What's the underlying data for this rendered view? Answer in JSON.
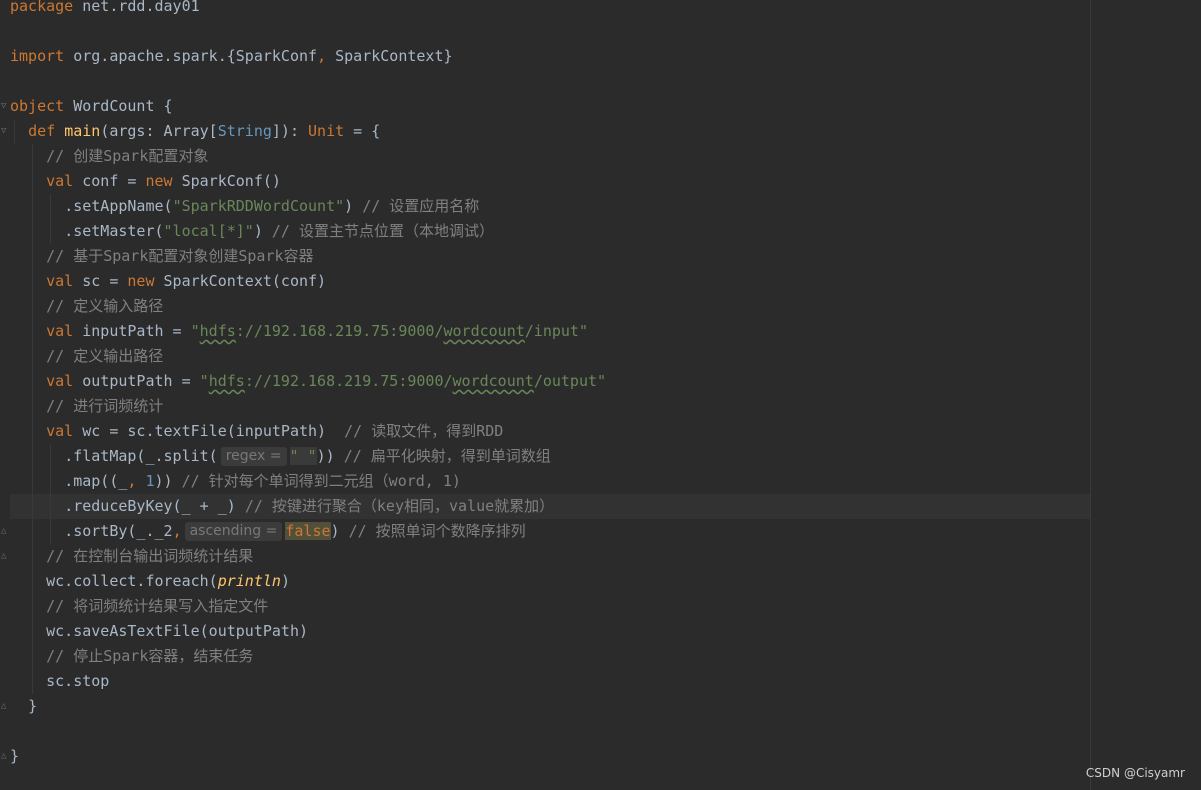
{
  "editor": {
    "language": "scala",
    "colors": {
      "background": "#2b2b2b",
      "keyword": "#cc7832",
      "function": "#ffc66d",
      "string": "#6a8759",
      "comment": "#808080",
      "number": "#6897bb",
      "plain": "#a9b7c6"
    }
  },
  "code": {
    "l1": {
      "kw": "package",
      "rest": " net.rdd.day01"
    },
    "l3": {
      "kw": "import",
      "rest": " org.apache.spark.{SparkConf",
      "comma": ",",
      "rest2": " SparkContext}"
    },
    "l5": {
      "kw": "object",
      "rest": " WordCount {"
    },
    "l6": {
      "kw": "def",
      "fn": "main",
      "a": "(args: Array[",
      "ty": "String",
      "b": "]): ",
      "ty2": "Unit",
      "c": " = {"
    },
    "l7": {
      "cm": "// 创建Spark配置对象"
    },
    "l8": {
      "kw": "val",
      "a": " conf = ",
      "kw2": "new",
      "b": " SparkConf()"
    },
    "l9": {
      "a": ".setAppName(",
      "str": "\"SparkRDDWordCount\"",
      "b": ") ",
      "cm": "// 设置应用名称"
    },
    "l10": {
      "a": ".setMaster(",
      "str": "\"local[*]\"",
      "b": ") ",
      "cm": "// 设置主节点位置（本地调试）"
    },
    "l11": {
      "cm": "// 基于Spark配置对象创建Spark容器"
    },
    "l12": {
      "kw": "val",
      "a": " sc = ",
      "kw2": "new",
      "b": " SparkContext(conf)"
    },
    "l13": {
      "cm": "// 定义输入路径"
    },
    "l14": {
      "kw": "val",
      "a": " inputPath = ",
      "s1": "\"",
      "s2": "hdfs",
      "s3": "://192.168.219.75:9000/",
      "s4": "wordcount",
      "s5": "/input\""
    },
    "l15": {
      "cm": "// 定义输出路径"
    },
    "l16": {
      "kw": "val",
      "a": " outputPath = ",
      "s1": "\"",
      "s2": "hdfs",
      "s3": "://192.168.219.75:9000/",
      "s4": "wordcount",
      "s5": "/output\""
    },
    "l17": {
      "cm": "// 进行词频统计"
    },
    "l18": {
      "kw": "val",
      "a": " wc = sc.textFile(inputPath)  ",
      "cm": "// 读取文件，得到RDD"
    },
    "l19": {
      "a": ".flatMap(_.split(",
      "hint": "regex =",
      "str": "\" \"",
      "b": ")) ",
      "cm": "// 扁平化映射，得到单词数组"
    },
    "l20": {
      "a": ".map((_",
      "comma": ",",
      "sp": " ",
      "num": "1",
      "b": ")) ",
      "cm": "// 针对每个单词得到二元组（word, 1)"
    },
    "l21": {
      "a": ".reduceByKey(_ + _) ",
      "cm": "// 按键进行聚合（key相同，value就累加）"
    },
    "l22": {
      "a": ".sortBy(_._2",
      "comma": ",",
      "hint": "ascending =",
      "kw": "false",
      "b": ") ",
      "cm": "// 按照单词个数降序排列"
    },
    "l23": {
      "cm": "// 在控制台输出词频统计结果"
    },
    "l24": {
      "a": "wc.collect.foreach(",
      "it": "println",
      "b": ")"
    },
    "l25": {
      "cm": "// 将词频统计结果写入指定文件"
    },
    "l26": {
      "a": "wc.saveAsTextFile(outputPath)"
    },
    "l27": {
      "cm": "// 停止Spark容器，结束任务"
    },
    "l28": {
      "a": "sc.stop"
    },
    "l29": {
      "a": "}"
    },
    "l31": {
      "a": "}"
    }
  },
  "watermark": {
    "text": "CSDN @Cisyamr"
  }
}
